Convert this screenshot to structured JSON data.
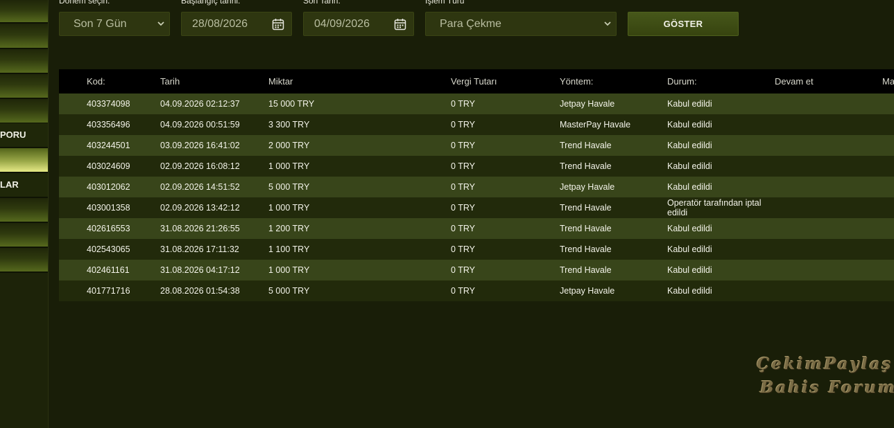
{
  "sidebar": {
    "items": [
      {
        "label": ""
      },
      {
        "label": ""
      },
      {
        "label": ""
      },
      {
        "label": ""
      },
      {
        "label": ""
      },
      {
        "label": "PORU"
      },
      {
        "label": ""
      },
      {
        "label": "LAR"
      },
      {
        "label": ""
      },
      {
        "label": ""
      },
      {
        "label": ""
      }
    ]
  },
  "filters": {
    "period_label": "Dönem seçin:",
    "period_value": "Son 7 Gün",
    "start_label": "Başlangıç tarihi:",
    "start_value": "28/08/2026",
    "end_label": "Son Tarih:",
    "end_value": "04/09/2026",
    "type_label": "İşlem Türü",
    "type_value": "Para Çekme",
    "show_button": "GÖSTER"
  },
  "table": {
    "headers": {
      "code": "Kod:",
      "date": "Tarih",
      "amount": "Miktar",
      "tax": "Vergi Tutarı",
      "method": "Yöntem:",
      "status": "Durum:",
      "continue": "Devam et",
      "extra": "Ma"
    },
    "rows": [
      {
        "code": "403374098",
        "date": "04.09.2026 02:12:37",
        "amount": "15 000 TRY",
        "tax": "0 TRY",
        "method": "Jetpay Havale",
        "status": "Kabul edildi"
      },
      {
        "code": "403356496",
        "date": "04.09.2026 00:51:59",
        "amount": "3 300 TRY",
        "tax": "0 TRY",
        "method": "MasterPay Havale",
        "status": "Kabul edildi"
      },
      {
        "code": "403244501",
        "date": "03.09.2026 16:41:02",
        "amount": "2 000 TRY",
        "tax": "0 TRY",
        "method": "Trend Havale",
        "status": "Kabul edildi"
      },
      {
        "code": "403024609",
        "date": "02.09.2026 16:08:12",
        "amount": "1 000 TRY",
        "tax": "0 TRY",
        "method": "Trend Havale",
        "status": "Kabul edildi"
      },
      {
        "code": "403012062",
        "date": "02.09.2026 14:51:52",
        "amount": "5 000 TRY",
        "tax": "0 TRY",
        "method": "Jetpay Havale",
        "status": "Kabul edildi"
      },
      {
        "code": "403001358",
        "date": "02.09.2026 13:42:12",
        "amount": "1 000 TRY",
        "tax": "0 TRY",
        "method": "Trend Havale",
        "status": "Operatör tarafından iptal edildi"
      },
      {
        "code": "402616553",
        "date": "31.08.2026 21:26:55",
        "amount": "1 200 TRY",
        "tax": "0 TRY",
        "method": "Trend Havale",
        "status": "Kabul edildi"
      },
      {
        "code": "402543065",
        "date": "31.08.2026 17:11:32",
        "amount": "1 100 TRY",
        "tax": "0 TRY",
        "method": "Trend Havale",
        "status": "Kabul edildi"
      },
      {
        "code": "402461161",
        "date": "31.08.2026 04:17:12",
        "amount": "1 000 TRY",
        "tax": "0 TRY",
        "method": "Trend Havale",
        "status": "Kabul edildi"
      },
      {
        "code": "401771716",
        "date": "28.08.2026 01:54:38",
        "amount": "5 000 TRY",
        "tax": "0 TRY",
        "method": "Jetpay Havale",
        "status": "Kabul edildi"
      }
    ]
  },
  "watermark": {
    "line1": "ÇekimPaylaş",
    "line2": "Bahis Forum"
  },
  "colors": {
    "background": "#191e08",
    "row_light": "#38451a",
    "row_dark": "#222a0b",
    "header": "#000000",
    "button": "#46571a"
  },
  "icons": {
    "select": "chevron-down-icon",
    "date": "calendar-icon"
  }
}
